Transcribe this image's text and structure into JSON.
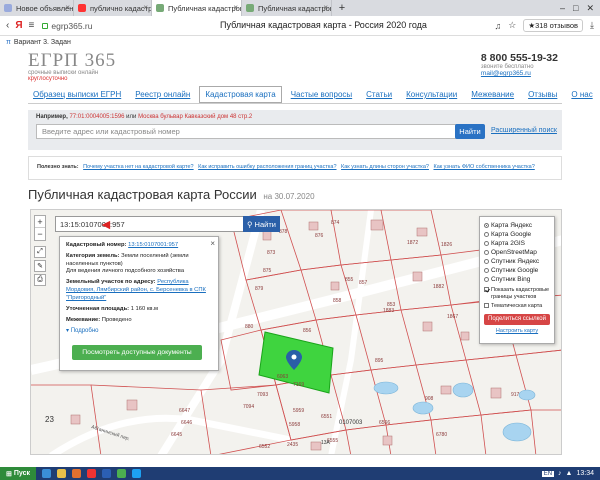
{
  "browser": {
    "tabs": [
      {
        "label": "Новое объявление — Обя",
        "active": false
      },
      {
        "label": "публично кадастровая ка",
        "active": false
      },
      {
        "label": "Публичная кадастровая к",
        "active": true
      },
      {
        "label": "Публичная кадастровая к",
        "active": false
      }
    ],
    "url": "egrp365.ru",
    "page_title": "Публичная кадастровая карта - Россия 2020 года",
    "reviews": "★318 отзывов",
    "bookmark": "Вариант 3. Задан"
  },
  "site": {
    "logo": "ЕГРП 365",
    "logo_sub1": "срочные выписки онлайн",
    "logo_sub2": "круглосуточно",
    "phone": "8 800 555-19-32",
    "free": "звоните бесплатно",
    "email": "mail@egrp365.ru"
  },
  "nav": [
    {
      "label": "Образец выписки ЕГРН",
      "active": false
    },
    {
      "label": "Реестр онлайн",
      "active": false
    },
    {
      "label": "Кадастровая карта",
      "active": true
    },
    {
      "label": "Частые вопросы",
      "active": false
    },
    {
      "label": "Статьи",
      "active": false
    },
    {
      "label": "Консультации",
      "active": false
    },
    {
      "label": "Межевание",
      "active": false
    },
    {
      "label": "Отзывы",
      "active": false
    },
    {
      "label": "О нас",
      "active": false
    }
  ],
  "search": {
    "example_label": "Например,",
    "example_number": "77:01:0004005:1596",
    "example_or": "или",
    "example_address": "Москва бульвар Кавказский дом 48 стр.2",
    "placeholder": "Введите адрес или кадастровый номер",
    "find": "Найти",
    "advanced": "Расширенный поиск"
  },
  "useful": {
    "label": "Полезно знать:",
    "links": [
      "Почему участка нет на кадастровой карте?",
      "Как исправить ошибку расположения границ участка?",
      "Как узнать длины сторон участка?",
      "Как узнать ФИО собственника участка?"
    ]
  },
  "heading": {
    "title": "Публичная кадастровая карта России",
    "date": "на 30.07.2020"
  },
  "map": {
    "search_value": "13:15:0107001:957",
    "find": "Найти",
    "info": {
      "cad_label": "Кадастровый номер:",
      "cad_value": "13:15:0107001:957",
      "cat_label": "Категория земель:",
      "cat_value": "Земли поселений (земли населенных пунктов)",
      "use_value": "Для ведения личного подсобного хозяйства",
      "addr_label": "Земельный участок по адресу:",
      "addr_value": "Республика Мордовия, Лямбирский район, с. Берсеневка в СПК \"Пригородный\"",
      "area_label": "Уточненная площадь:",
      "area_value": "1 160 кв.м",
      "survey_label": "Межевание:",
      "survey_value": "Проведено",
      "more": "Подробно",
      "button": "Посмотреть доступные документы"
    },
    "layers": [
      {
        "label": "Карта Яндекс",
        "selected": true
      },
      {
        "label": "Карта Google",
        "selected": false
      },
      {
        "label": "Карта 2GIS",
        "selected": false
      },
      {
        "label": "OpenStreetMap",
        "selected": false
      },
      {
        "label": "Спутник Яндекс",
        "selected": false
      },
      {
        "label": "Спутник Google",
        "selected": false
      },
      {
        "label": "Спутник Bing",
        "selected": false
      }
    ],
    "show_borders": "Показать кадастровые границы участков",
    "thematic": "Тематическая карта",
    "share": "Поделиться ссылкой",
    "settings": "Настроить карту",
    "labels": [
      "878",
      "876",
      "873",
      "875",
      "879",
      "880",
      "856",
      "857",
      "855",
      "858",
      "853",
      "1883",
      "1882",
      "1872",
      "1826",
      "6063",
      "7169",
      "7093",
      "7094",
      "5959",
      "5958",
      "6555",
      "6566",
      "6780",
      "6647",
      "6646",
      "6645",
      "0107003",
      "13A",
      "23",
      "908",
      "917",
      "895",
      "874",
      "1867",
      "2435",
      "6551",
      "6552"
    ],
    "street": "Абганинский пер."
  },
  "taskbar": {
    "start": "Пуск",
    "lang": "EN",
    "time": "13:34"
  }
}
